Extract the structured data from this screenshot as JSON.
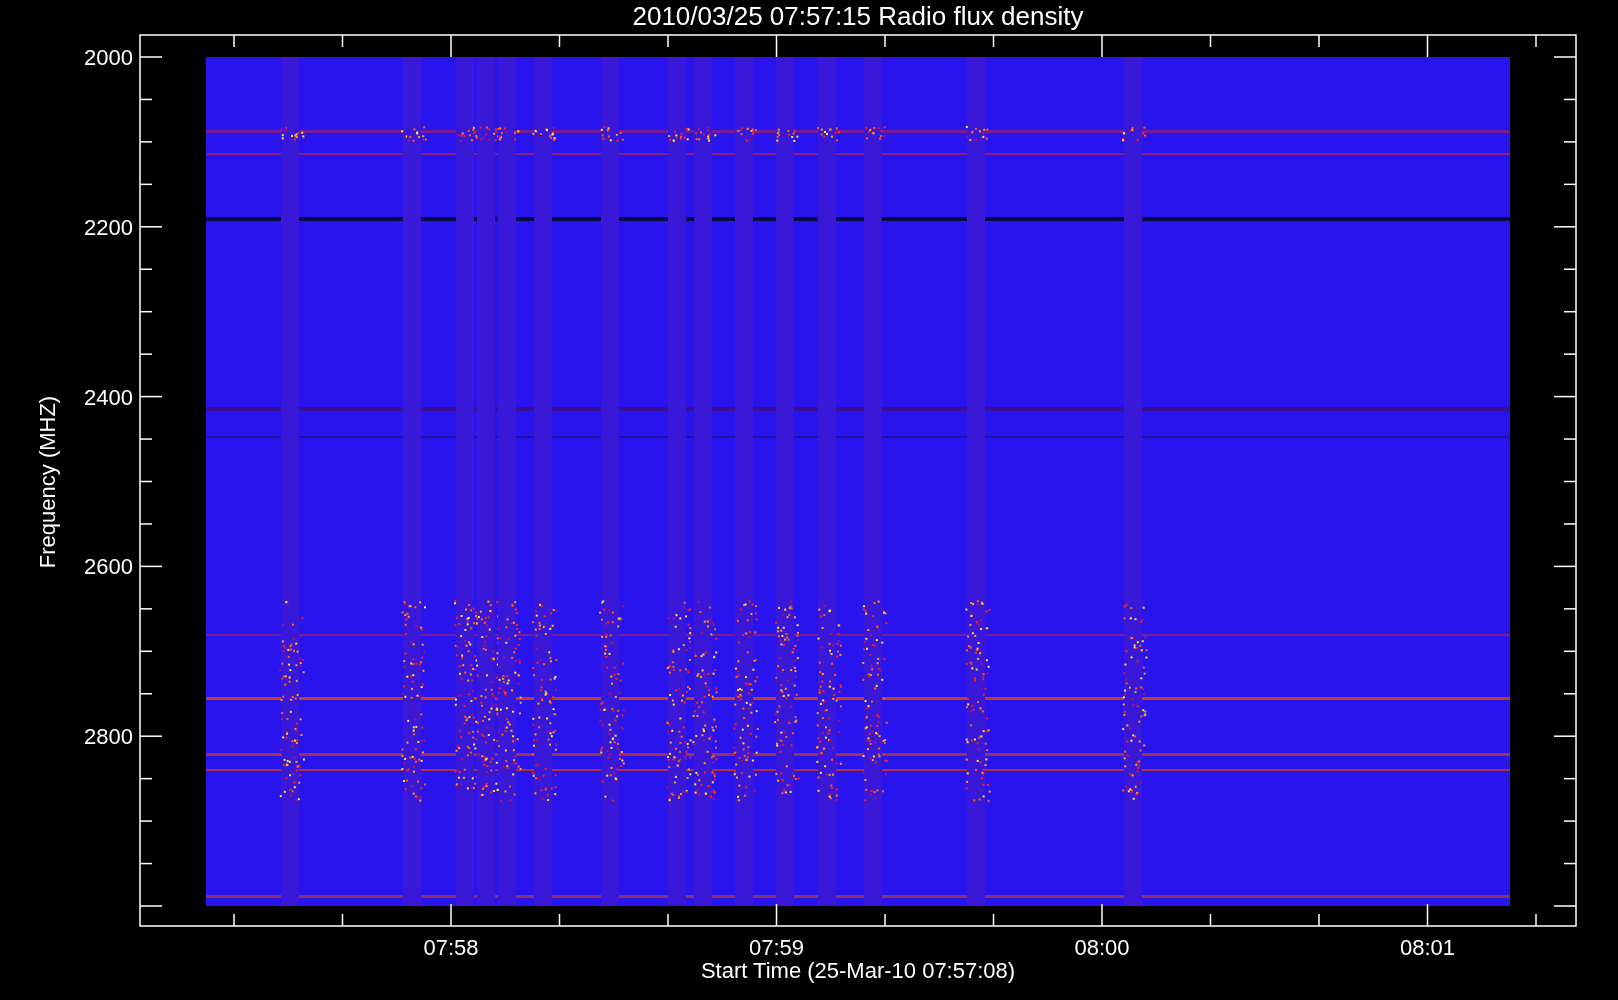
{
  "title": "2010/03/25 07:57:15 Radio flux density",
  "y_axis": {
    "label": "Frequency (MHZ)",
    "ticks": [
      "2000",
      "2200",
      "2400",
      "2600",
      "2800"
    ]
  },
  "x_axis": {
    "label": "Start Time (25-Mar-10 07:57:08)",
    "ticks": [
      "07:58",
      "07:59",
      "08:00",
      "08:01"
    ]
  }
}
